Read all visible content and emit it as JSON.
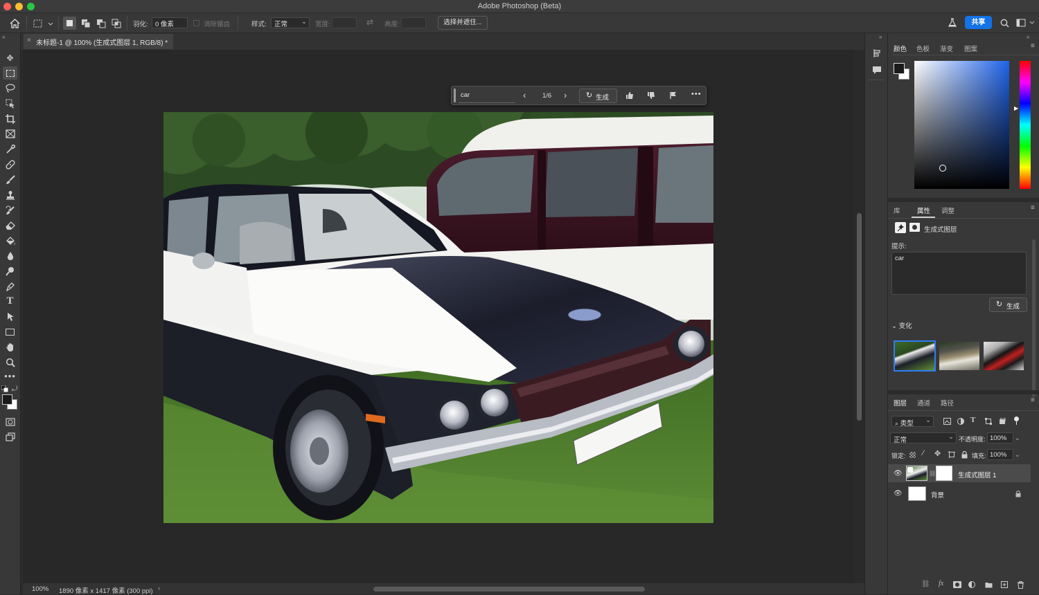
{
  "app": {
    "title": "Adobe Photoshop (Beta)"
  },
  "options_bar": {
    "feather_label": "羽化:",
    "feather_value": "0 像素",
    "antialias_label": "消除锯齿",
    "style_label": "样式:",
    "style_value": "正常",
    "width_label": "宽度:",
    "height_label": "高度:",
    "select_mask_button": "选择并遮住...",
    "share_button": "共享"
  },
  "document": {
    "tab_title": "未标题-1 @ 100% (生成式图层 1, RGB/8) *",
    "zoom": "100%",
    "doc_info": "1890 像素 x 1417 像素 (300 ppi)"
  },
  "generate_bar": {
    "prompt": "car",
    "variation_counter": "1/6",
    "generate_label": "生成"
  },
  "color_panel": {
    "tabs": [
      "颜色",
      "色板",
      "渐变",
      "图案"
    ],
    "foreground": "#1a1a1a",
    "background": "#ffffff",
    "hue_color": "#1f63e8"
  },
  "properties_panel": {
    "tabs": [
      "库",
      "属性",
      "调整"
    ],
    "layer_type": "生成式图层",
    "prompt_label": "提示:",
    "prompt_value": "car",
    "generate_button": "生成",
    "variations_label": "变化"
  },
  "layers_panel": {
    "tabs": [
      "图层",
      "通道",
      "路径"
    ],
    "filter_label": "类型",
    "blend_mode": "正常",
    "opacity_label": "不透明度:",
    "opacity_value": "100%",
    "lock_label": "锁定:",
    "fill_label": "填充:",
    "fill_value": "100%",
    "layers": [
      {
        "name": "生成式图层 1",
        "selected": true
      },
      {
        "name": "背景",
        "selected": false,
        "locked": true
      }
    ]
  },
  "colors": {
    "accent": "#1473e6",
    "car_black": "#1c1e28",
    "van_maroon": "#3a1420",
    "grass": "#4f7a2e"
  }
}
